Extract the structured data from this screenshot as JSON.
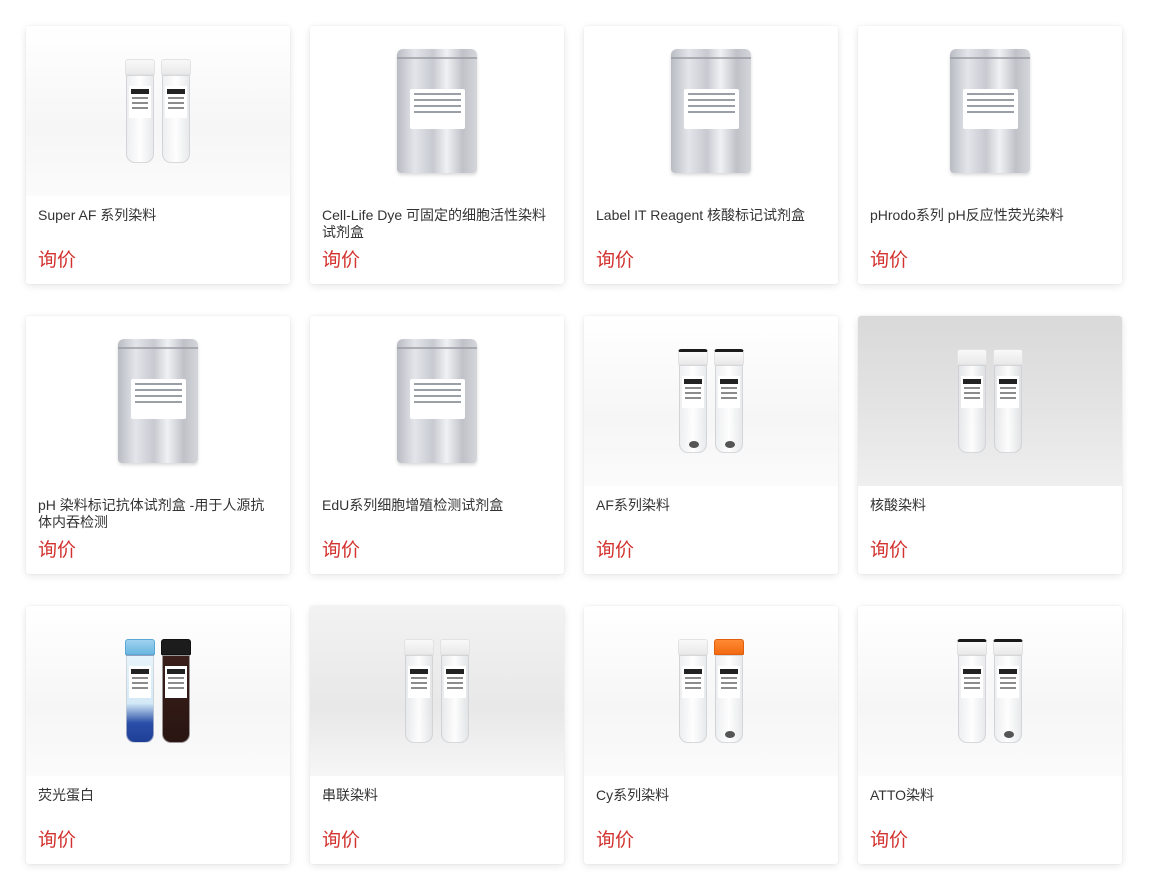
{
  "products": [
    {
      "title": "Super AF 系列染料",
      "price_label": "询价",
      "image": "vial-pair",
      "bg": "light"
    },
    {
      "title": "Cell-Life Dye 可固定的细胞活性染料试剂盒",
      "price_label": "询价",
      "image": "foil-pouch",
      "bg": "white"
    },
    {
      "title": "Label IT Reagent 核酸标记试剂盒",
      "price_label": "询价",
      "image": "foil-pouch",
      "bg": "white"
    },
    {
      "title": "pHrodo系列 pH反应性荧光染料",
      "price_label": "询价",
      "image": "foil-pouch",
      "bg": "white"
    },
    {
      "title": "pH 染料标记抗体试剂盒 -用于人源抗体内吞检测",
      "price_label": "询价",
      "image": "foil-pouch",
      "bg": "white"
    },
    {
      "title": "EdU系列细胞增殖检测试剂盒",
      "price_label": "询价",
      "image": "foil-pouch",
      "bg": "white"
    },
    {
      "title": "AF系列染料",
      "price_label": "询价",
      "image": "vial-pair",
      "bg": "light"
    },
    {
      "title": "核酸染料",
      "price_label": "询价",
      "image": "vial-pair",
      "bg": "mid"
    },
    {
      "title": "荧光蛋白",
      "price_label": "询价",
      "image": "vial-pair-blue-dark",
      "bg": "light"
    },
    {
      "title": "串联染料",
      "price_label": "询价",
      "image": "vial-pair",
      "bg": "grey"
    },
    {
      "title": "Cy系列染料",
      "price_label": "询价",
      "image": "vial-pair-orange",
      "bg": "light"
    },
    {
      "title": "ATTO染料",
      "price_label": "询价",
      "image": "vial-pair",
      "bg": "light"
    }
  ],
  "colors": {
    "price": "#d2332f",
    "title": "#333333",
    "card_bg": "#ffffff"
  }
}
